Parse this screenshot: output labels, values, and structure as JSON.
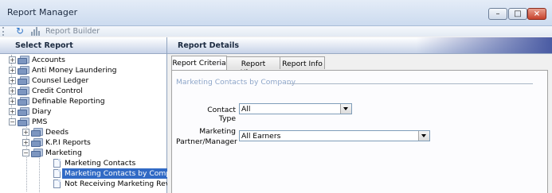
{
  "window": {
    "title": "Report Manager",
    "minimize_icon": "minimize-icon",
    "maximize_icon": "maximize-icon",
    "close_icon": "close-icon"
  },
  "toolbar": {
    "refresh_icon": "refresh-icon",
    "builder_icon": "report-builder-icon",
    "builder_label": "Report Builder"
  },
  "left_pane": {
    "header": "Select Report",
    "tree": [
      {
        "label": "Accounts",
        "type": "folder",
        "expander": "+"
      },
      {
        "label": "Anti Money Laundering",
        "type": "folder",
        "expander": "+"
      },
      {
        "label": "Counsel Ledger",
        "type": "folder",
        "expander": "+"
      },
      {
        "label": "Credit Control",
        "type": "folder",
        "expander": "+"
      },
      {
        "label": "Definable Reporting",
        "type": "folder",
        "expander": "+"
      },
      {
        "label": "Diary",
        "type": "folder",
        "expander": "+"
      },
      {
        "label": "PMS",
        "type": "folder",
        "expander": "−"
      },
      {
        "label": "Deeds",
        "type": "folder",
        "expander": "+"
      },
      {
        "label": "K.P.I Reports",
        "type": "folder",
        "expander": "+"
      },
      {
        "label": "Marketing",
        "type": "folder",
        "expander": "−"
      },
      {
        "label": "Marketing Contacts",
        "type": "report"
      },
      {
        "label": "Marketing Contacts by Company",
        "type": "report",
        "selected": true
      },
      {
        "label": "Not Receiving Marketing Review",
        "type": "report"
      }
    ]
  },
  "right_pane": {
    "header": "Report Details",
    "tabs": [
      {
        "label": "Report Criteria",
        "active": true
      },
      {
        "label": "Report History",
        "active": false
      },
      {
        "label": "Report Info",
        "active": false
      }
    ],
    "section_title": "Marketing Contacts by Company",
    "fields": [
      {
        "label": "Contact Type",
        "value": "All"
      },
      {
        "label_line1": "Marketing",
        "label_line2": "Partner/Manager",
        "value": "All Earners"
      }
    ]
  },
  "colors": {
    "selection": "#316ac5",
    "section_title": "#8ea6c9",
    "header_accent": "#4a5ba3"
  }
}
